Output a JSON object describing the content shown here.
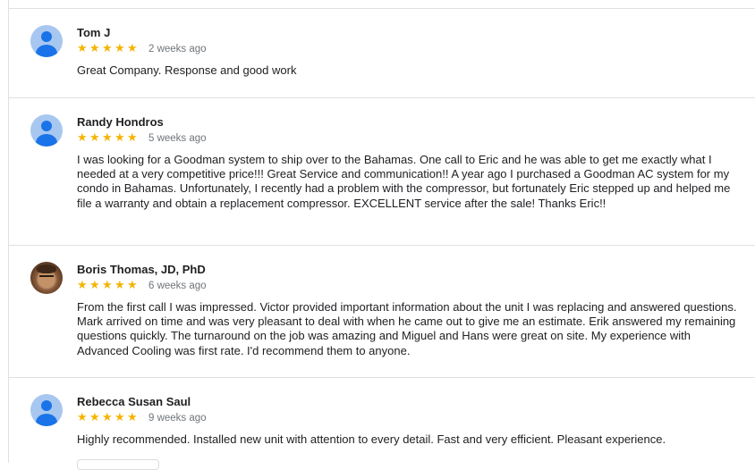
{
  "reviews": [
    {
      "author": "Tom J",
      "avatar_icon": "default-avatar-icon",
      "rating": 5,
      "date": "2 weeks ago",
      "text": "Great Company. Response and good work"
    },
    {
      "author": "Randy Hondros",
      "avatar_icon": "default-avatar-icon",
      "rating": 5,
      "date": "5 weeks ago",
      "text": "I was looking for a Goodman system to ship over to the Bahamas. One call to Eric and he was able to get me exactly what I needed at a very competitive price!!! Great Service and communication!! A year ago I purchased a Goodman AC system for my condo in Bahamas. Unfortunately, I recently had a problem with the compressor, but fortunately Eric stepped up and helped me file a warranty and obtain a replacement compressor. EXCELLENT service after the sale! Thanks Eric!!"
    },
    {
      "author": "Boris Thomas, JD, PhD",
      "avatar_icon": "profile-photo",
      "rating": 5,
      "date": "6 weeks ago",
      "text": "From the first call I was impressed. Victor provided important information about the unit I was replacing and answered questions. Mark arrived on time and was very pleasant to deal with when he came out to give me an estimate. Erik answered my remaining questions quickly. The turnaround on the job was amazing and Miguel and Hans were great on site. My experience with Advanced Cooling was first rate. I'd recommend them to anyone."
    },
    {
      "author": "Rebecca Susan Saul",
      "avatar_icon": "default-avatar-icon",
      "rating": 5,
      "date": "9 weeks ago",
      "text": "Highly recommended. Installed new unit with attention to every detail. Fast and very efficient. Pleasant experience."
    }
  ],
  "colors": {
    "star": "#f4b400",
    "avatar_bg": "#a8c7f0",
    "avatar_fg": "#1a73e8",
    "divider": "#e0e0e0",
    "date": "#70757a"
  },
  "star_glyph": "★"
}
